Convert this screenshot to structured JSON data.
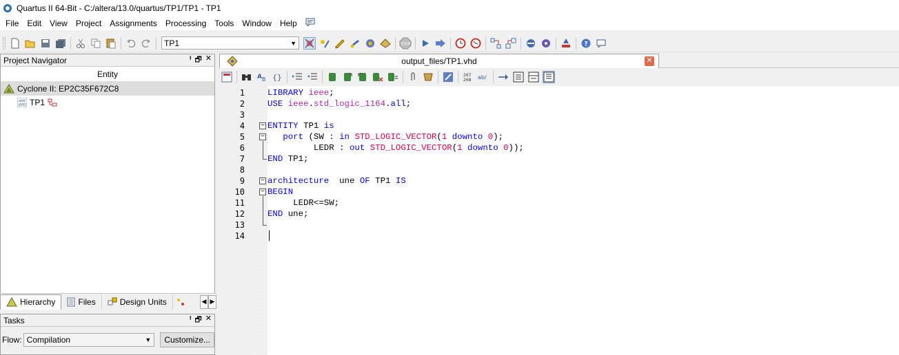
{
  "window": {
    "title": "Quartus II 64-Bit - C:/altera/13.0/quartus/TP1/TP1 - TP1"
  },
  "menu": [
    "File",
    "Edit",
    "View",
    "Project",
    "Assignments",
    "Processing",
    "Tools",
    "Window",
    "Help"
  ],
  "toolbar": {
    "project_combo": "TP1"
  },
  "project_navigator": {
    "title": "Project Navigator",
    "column_header": "Entity",
    "device": "Cyclone II: EP2C35F672C8",
    "top_entity": "TP1"
  },
  "nav_tabs": [
    {
      "label": "Hierarchy",
      "icon": "hierarchy-icon"
    },
    {
      "label": "Files",
      "icon": "files-icon"
    },
    {
      "label": "Design Units",
      "icon": "design-units-icon"
    }
  ],
  "tasks": {
    "title": "Tasks",
    "flow_label": "Flow:",
    "flow_value": "Compilation",
    "customize_label": "Customize..."
  },
  "editor": {
    "tab_label": "output_files/TP1.vhd",
    "line_numbers": [
      "1",
      "2",
      "3",
      "4",
      "5",
      "6",
      "7",
      "8",
      "9",
      "10",
      "11",
      "12",
      "13",
      "14"
    ],
    "lines": [
      [
        {
          "t": "LIBRARY ",
          "c": "kw"
        },
        {
          "t": "ieee",
          "c": "lib"
        },
        {
          "t": ";",
          "c": ""
        }
      ],
      [
        {
          "t": "USE ",
          "c": "kw"
        },
        {
          "t": "ieee",
          "c": "lib"
        },
        {
          "t": ".",
          "c": ""
        },
        {
          "t": "std_logic_1164",
          "c": "lib"
        },
        {
          "t": ".",
          "c": ""
        },
        {
          "t": "all",
          "c": "kw"
        },
        {
          "t": ";",
          "c": ""
        }
      ],
      [],
      [
        {
          "t": "ENTITY ",
          "c": "kw"
        },
        {
          "t": "TP1 ",
          "c": ""
        },
        {
          "t": "is",
          "c": "kw"
        }
      ],
      [
        {
          "t": "   port ",
          "c": "kw"
        },
        {
          "t": "(SW : ",
          "c": ""
        },
        {
          "t": "in ",
          "c": "kw"
        },
        {
          "t": "STD_LOGIC_VECTOR",
          "c": "typ"
        },
        {
          "t": "(",
          "c": ""
        },
        {
          "t": "1 ",
          "c": "num"
        },
        {
          "t": "downto ",
          "c": "kw"
        },
        {
          "t": "0",
          "c": "num"
        },
        {
          "t": ");",
          "c": ""
        }
      ],
      [
        {
          "t": "         LEDR : ",
          "c": ""
        },
        {
          "t": "out ",
          "c": "kw"
        },
        {
          "t": "STD_LOGIC_VECTOR",
          "c": "typ"
        },
        {
          "t": "(",
          "c": ""
        },
        {
          "t": "1 ",
          "c": "num"
        },
        {
          "t": "downto ",
          "c": "kw"
        },
        {
          "t": "0",
          "c": "num"
        },
        {
          "t": "));",
          "c": ""
        }
      ],
      [
        {
          "t": "END ",
          "c": "kw"
        },
        {
          "t": "TP1;",
          "c": ""
        }
      ],
      [],
      [
        {
          "t": "architecture ",
          "c": "kw"
        },
        {
          "t": " une ",
          "c": ""
        },
        {
          "t": "OF ",
          "c": "kw"
        },
        {
          "t": "TP1 ",
          "c": ""
        },
        {
          "t": "IS",
          "c": "kw"
        }
      ],
      [
        {
          "t": "BEGIN",
          "c": "kw"
        }
      ],
      [
        {
          "t": "     LEDR<=SW;",
          "c": ""
        }
      ],
      [
        {
          "t": "END ",
          "c": "kw"
        },
        {
          "t": "une;",
          "c": ""
        }
      ],
      [],
      []
    ]
  }
}
